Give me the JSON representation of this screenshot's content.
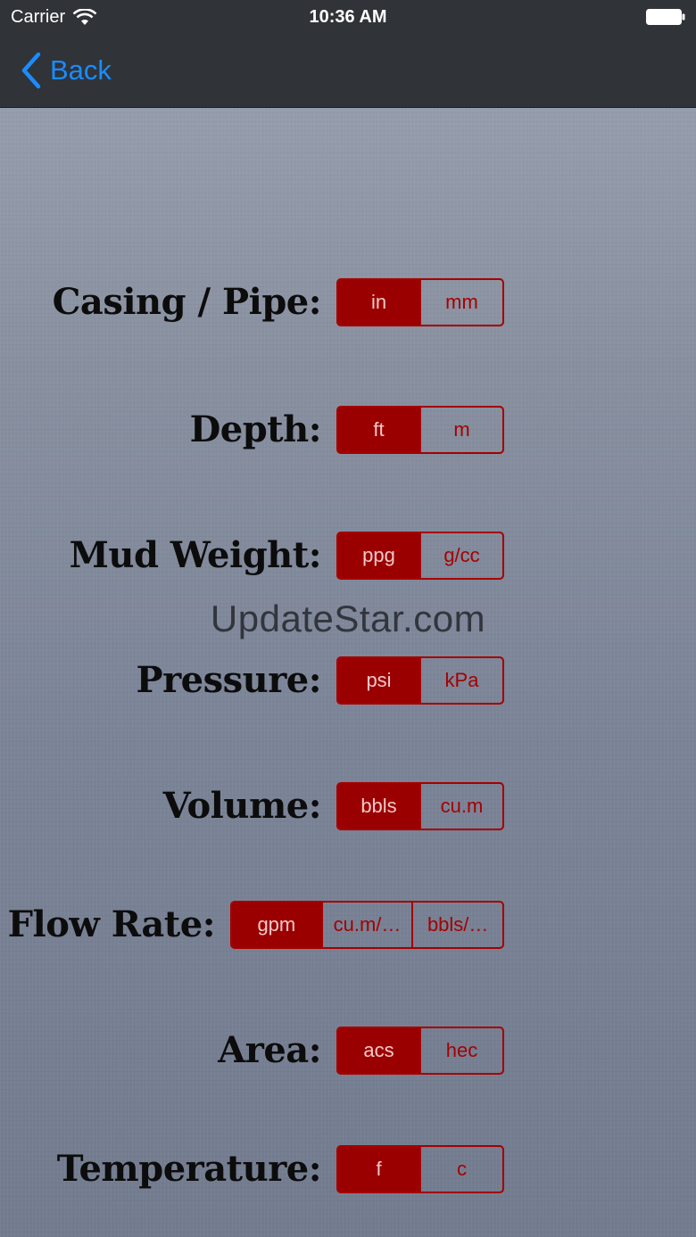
{
  "status_bar": {
    "carrier": "Carrier",
    "time": "10:36 AM"
  },
  "nav": {
    "back_label": "Back"
  },
  "watermark": "UpdateStar.com",
  "colors": {
    "accent_red": "#9a0000",
    "nav_blue": "#1a8cff",
    "bar_bg": "#303338"
  },
  "settings": [
    {
      "label": "Casing / Pipe:",
      "options": [
        "in",
        "mm"
      ],
      "selected": 0
    },
    {
      "label": "Depth:",
      "options": [
        "ft",
        "m"
      ],
      "selected": 0
    },
    {
      "label": "Mud Weight:",
      "options": [
        "ppg",
        "g/cc"
      ],
      "selected": 0
    },
    {
      "label": "Pressure:",
      "options": [
        "psi",
        "kPa"
      ],
      "selected": 0
    },
    {
      "label": "Volume:",
      "options": [
        "bbls",
        "cu.m"
      ],
      "selected": 0
    },
    {
      "label": "Flow Rate:",
      "options": [
        "gpm",
        "cu.m/…",
        "bbls/…"
      ],
      "selected": 0
    },
    {
      "label": "Area:",
      "options": [
        "acs",
        "hec"
      ],
      "selected": 0
    },
    {
      "label": "Temperature:",
      "options": [
        "f",
        "c"
      ],
      "selected": 0
    }
  ]
}
